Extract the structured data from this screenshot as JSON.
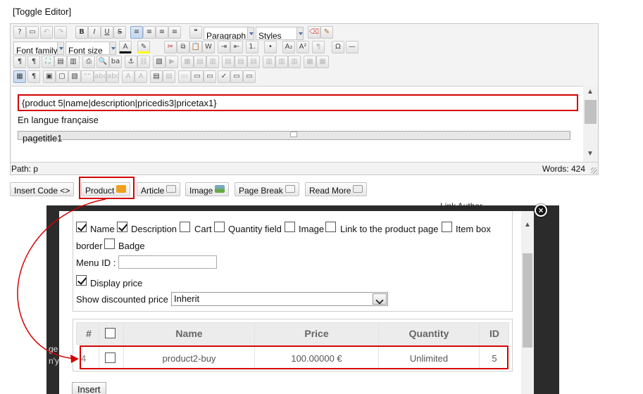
{
  "toggle_editor": "[Toggle Editor]",
  "toolbar": {
    "format_select": "Paragraph",
    "styles_select": "Styles",
    "font_family_select": "Font family",
    "font_size_select": "Font size"
  },
  "editor": {
    "shortcode": "{product 5|name|description|pricedis3|pricetax1}",
    "paragraph": "En langue française",
    "pagebreak_title": "pagetitle1",
    "path": "Path: p",
    "words": "Words: 424"
  },
  "plugin_buttons": {
    "insert_code": "Insert Code <>",
    "product": "Product",
    "article": "Article",
    "image": "Image",
    "page_break": "Page Break",
    "read_more": "Read More"
  },
  "background_text": {
    "link_author": "Link Author",
    "fragment1": "ge",
    "fragment2": "n'y"
  },
  "modal": {
    "close": "×",
    "options": {
      "name": "Name",
      "description": "Description",
      "cart": "Cart",
      "quantity_field": "Quantity field",
      "image": "Image",
      "link_to_product": "Link to the product page",
      "item_box": "Item box",
      "border": "border",
      "badge": "Badge",
      "menu_id_label": "Menu ID :",
      "menu_id_value": "",
      "display_price": "Display price",
      "show_discounted_label": "Show discounted price",
      "show_discounted_value": "Inherit"
    },
    "table": {
      "headers": [
        "#",
        "",
        "Name",
        "Price",
        "Quantity",
        "ID"
      ],
      "rows": [
        {
          "num": "4",
          "name": "product2-buy",
          "price": "100.00000 €",
          "quantity": "Unlimited",
          "id": "5"
        }
      ]
    },
    "insert_button": "Insert"
  },
  "colors": {
    "highlight": "#d40000",
    "overlay": "#2b2b2b"
  }
}
